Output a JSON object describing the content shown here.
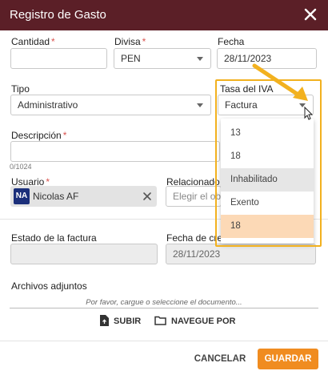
{
  "dialog": {
    "title": "Registro de Gasto"
  },
  "form": {
    "cantidad": {
      "label": "Cantidad",
      "required": "*",
      "value": ""
    },
    "divisa": {
      "label": "Divisa",
      "required": "*",
      "value": "PEN"
    },
    "fecha": {
      "label": "Fecha",
      "value": "28/11/2023"
    },
    "tipo": {
      "label": "Tipo",
      "value": "Administrativo"
    },
    "tasa_iva": {
      "label": "Tasa del IVA",
      "value": "Factura"
    },
    "descripcion": {
      "label": "Descripción",
      "required": "*",
      "value": "",
      "counter": "0/1024"
    },
    "usuario": {
      "label": "Usuario",
      "required": "*",
      "avatar_initials": "NA",
      "chip_name": "Nicolas AF",
      "avatar_color": "#1b2f7a"
    },
    "relacionado": {
      "label": "Relacionado c",
      "placeholder": "Elegir el obe"
    },
    "estado_factura": {
      "label": "Estado de la factura",
      "value": ""
    },
    "fecha_creacion": {
      "label": "Fecha de crea",
      "value": "28/11/2023"
    }
  },
  "attachments": {
    "label": "Archivos adjuntos",
    "hint": "Por favor, cargue o seleccione el documento...",
    "upload_label": "SUBIR",
    "browse_label": "NAVEGUE POR"
  },
  "tax_dropdown": {
    "options": [
      "13",
      "18",
      "Inhabilitado",
      "Exento",
      "18"
    ],
    "hover_index": 2,
    "selected_index": 4
  },
  "footer": {
    "cancel_label": "CANCELAR",
    "save_label": "GUARDAR"
  },
  "colors": {
    "header": "#5b1f27",
    "accent": "#f08c20",
    "highlight": "#f2b11f",
    "selected_option": "#fcd9b6",
    "required": "#d9534f"
  }
}
